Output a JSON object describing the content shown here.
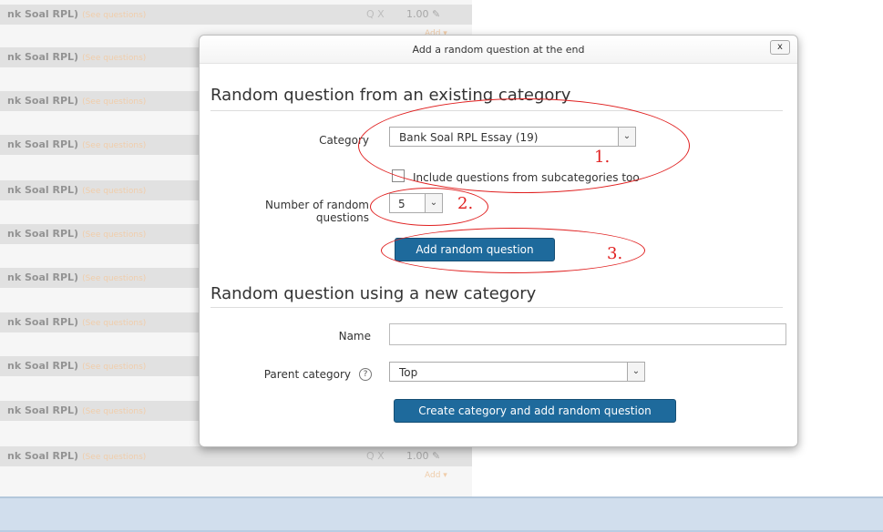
{
  "background": {
    "slot_title": "nk Soal RPL)",
    "see_questions": "(See questions)",
    "mark": "1.00",
    "tools": "Q X",
    "add_link": "Add ▾"
  },
  "dialog": {
    "title": "Add a random question at the end",
    "close_label": "x",
    "existing_section": {
      "heading": "Random question from an existing category",
      "category_label": "Category",
      "category_value": "Bank Soal RPL Essay (19)",
      "subcategories_label": "Include questions from subcategories too",
      "number_label_line1": "Number of random",
      "number_label_line2": "questions",
      "number_value": "5",
      "add_button": "Add random question"
    },
    "new_section": {
      "heading": "Random question using a new category",
      "name_label": "Name",
      "name_value": "",
      "parent_label": "Parent category",
      "parent_value": "Top",
      "create_button": "Create category and add random question"
    }
  },
  "annotations": {
    "one": "1.",
    "two": "2.",
    "three": "3."
  },
  "colors": {
    "primary_button": "#1e6a9c",
    "annotation": "#e02020",
    "footer": "#b8cde3"
  }
}
